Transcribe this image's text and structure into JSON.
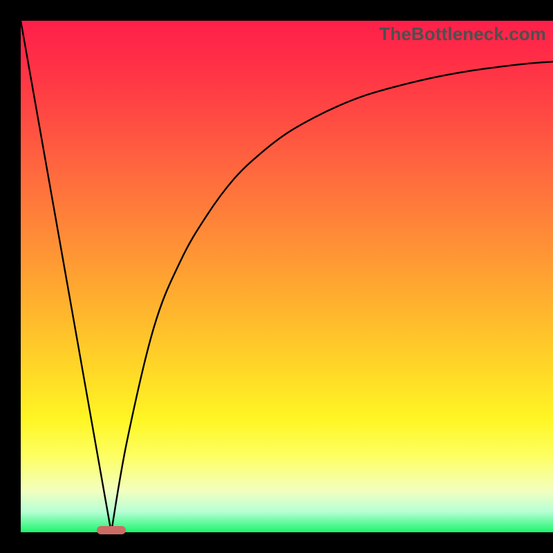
{
  "watermark": "TheBottleneck.com",
  "colors": {
    "gradient_top": "#ff1f4a",
    "gradient_bottom": "#1cf56c",
    "curve": "#000000",
    "marker": "#cc6b66",
    "frame": "#000000"
  },
  "chart_data": {
    "type": "line",
    "title": "",
    "xlabel": "",
    "ylabel": "",
    "xlim": [
      0,
      100
    ],
    "ylim": [
      0,
      100
    ],
    "grid": false,
    "legend": false,
    "series": [
      {
        "name": "left-linear-descent",
        "x": [
          0,
          17
        ],
        "y": [
          100,
          0
        ]
      },
      {
        "name": "right-log-rise",
        "x": [
          17,
          20,
          25,
          30,
          35,
          40,
          45,
          50,
          55,
          60,
          65,
          70,
          75,
          80,
          85,
          90,
          95,
          100
        ],
        "y": [
          0,
          18,
          40,
          53,
          62,
          69,
          74,
          78,
          81,
          83.5,
          85.5,
          87,
          88.3,
          89.4,
          90.3,
          91,
          91.6,
          92
        ]
      }
    ],
    "marker": {
      "x_center": 17,
      "y": 0,
      "width_percent": 5.4
    }
  }
}
